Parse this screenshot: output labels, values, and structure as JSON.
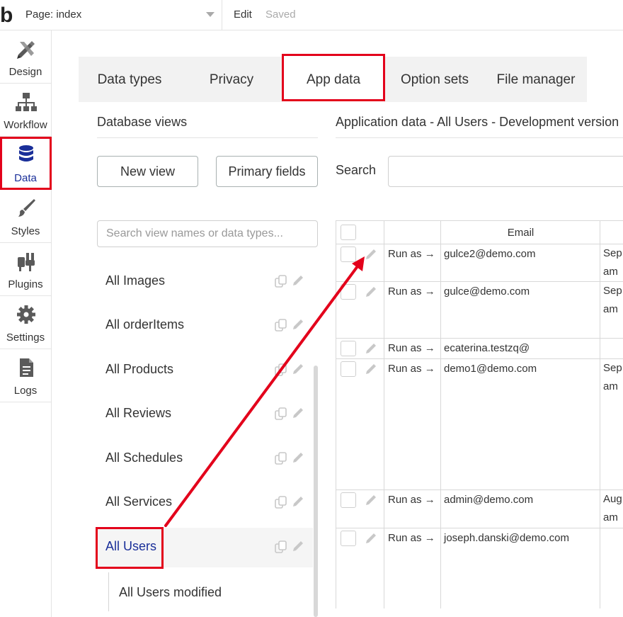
{
  "topbar": {
    "logo": "b",
    "page_label": "Page: index",
    "edit_label": "Edit",
    "saved_label": "Saved"
  },
  "sidebar": {
    "items": [
      {
        "label": "Design",
        "icon": "design-icon"
      },
      {
        "label": "Workflow",
        "icon": "workflow-icon"
      },
      {
        "label": "Data",
        "icon": "database-icon",
        "active": true
      },
      {
        "label": "Styles",
        "icon": "brush-icon"
      },
      {
        "label": "Plugins",
        "icon": "plug-icon"
      },
      {
        "label": "Settings",
        "icon": "gear-icon"
      },
      {
        "label": "Logs",
        "icon": "document-icon"
      }
    ]
  },
  "tabs": [
    {
      "label": "Data types"
    },
    {
      "label": "Privacy"
    },
    {
      "label": "App data",
      "active": true
    },
    {
      "label": "Option sets"
    },
    {
      "label": "File manager"
    }
  ],
  "database_views": {
    "title": "Database views",
    "new_view_label": "New view",
    "primary_fields_label": "Primary fields",
    "search_placeholder": "Search view names or data types...",
    "views": [
      {
        "name": "All Images"
      },
      {
        "name": "All orderItems"
      },
      {
        "name": "All Products"
      },
      {
        "name": "All Reviews"
      },
      {
        "name": "All Schedules"
      },
      {
        "name": "All Services"
      },
      {
        "name": "All Users",
        "active": true
      }
    ],
    "sub_view": "All Users modified"
  },
  "app_data": {
    "title": "Application data - All Users - Development version",
    "search_label": "Search",
    "email_header": "Email",
    "run_as_label": "Run as →",
    "rows": [
      {
        "email": "gulce2@demo.com",
        "date_line1": "Sep",
        "date_line2": "am"
      },
      {
        "email": "gulce@demo.com",
        "date_line1": "Sep",
        "date_line2": "am"
      },
      {
        "email": "ecaterina.testzq@",
        "date_line1": "",
        "date_line2": ""
      },
      {
        "email": "demo1@demo.com",
        "date_line1": "Sep",
        "date_line2": "am"
      },
      {
        "email": "admin@demo.com",
        "date_line1": "Aug",
        "date_line2": "am"
      },
      {
        "email": "joseph.danski@demo.com",
        "date_line1": "",
        "date_line2": ""
      }
    ]
  },
  "colors": {
    "accent_blue": "#1a2f99",
    "highlight_red": "#e3001b"
  }
}
